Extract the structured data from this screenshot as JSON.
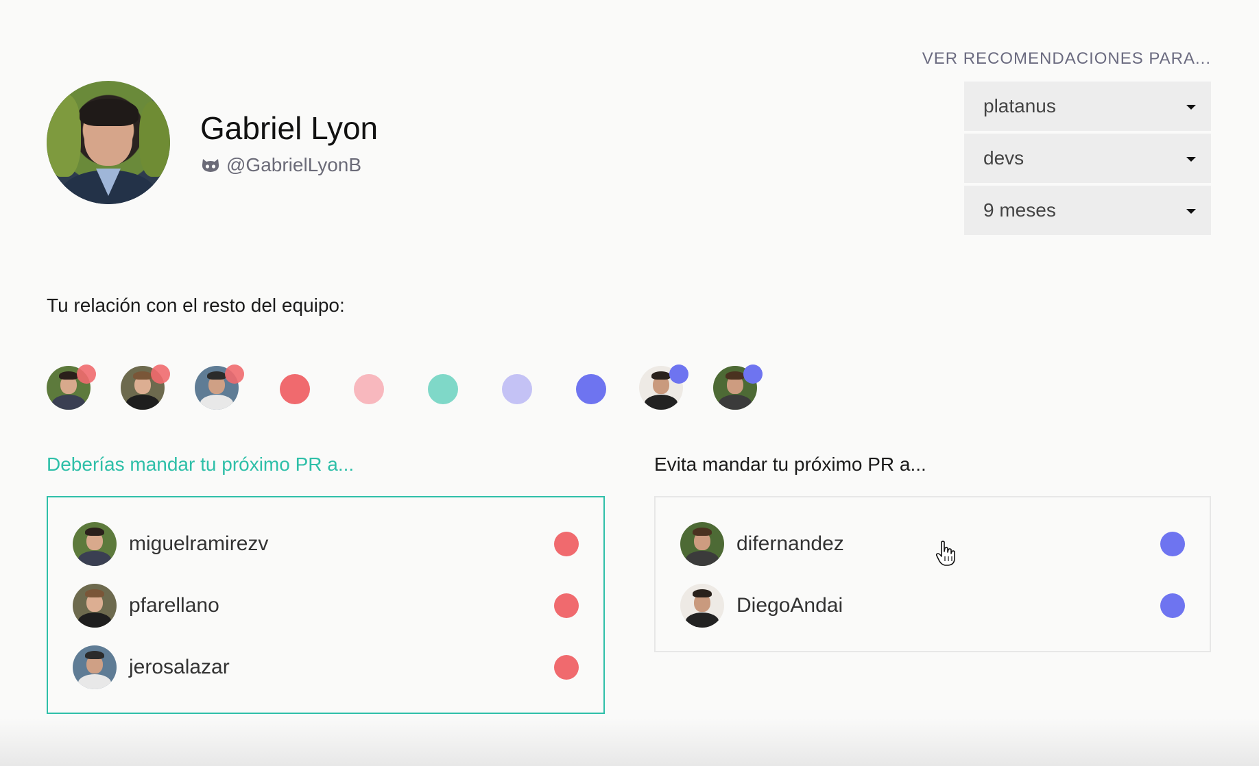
{
  "profile": {
    "name": "Gabriel Lyon",
    "handle": "@GabrielLyonB",
    "handle_icon": "github-icon"
  },
  "recommendations": {
    "title": "VER RECOMENDACIONES PARA...",
    "selects": [
      {
        "value": "platanus"
      },
      {
        "value": "devs"
      },
      {
        "value": "9 meses"
      }
    ]
  },
  "team": {
    "title": "Tu relación con el resto del equipo:",
    "colors": {
      "red": "#f06a6e",
      "pink": "#f8b8be",
      "teal": "#7fd8c8",
      "lavender": "#c4c2f5",
      "blue": "#6e74f0"
    }
  },
  "good": {
    "title": "Deberías mandar tu próximo PR a...",
    "accent": "#2ebfa8",
    "items": [
      {
        "name": "miguelramirezv"
      },
      {
        "name": "pfarellano"
      },
      {
        "name": "jerosalazar"
      }
    ]
  },
  "bad": {
    "title": "Evita mandar tu próximo PR a...",
    "items": [
      {
        "name": "difernandez"
      },
      {
        "name": "DiegoAndai"
      }
    ]
  }
}
